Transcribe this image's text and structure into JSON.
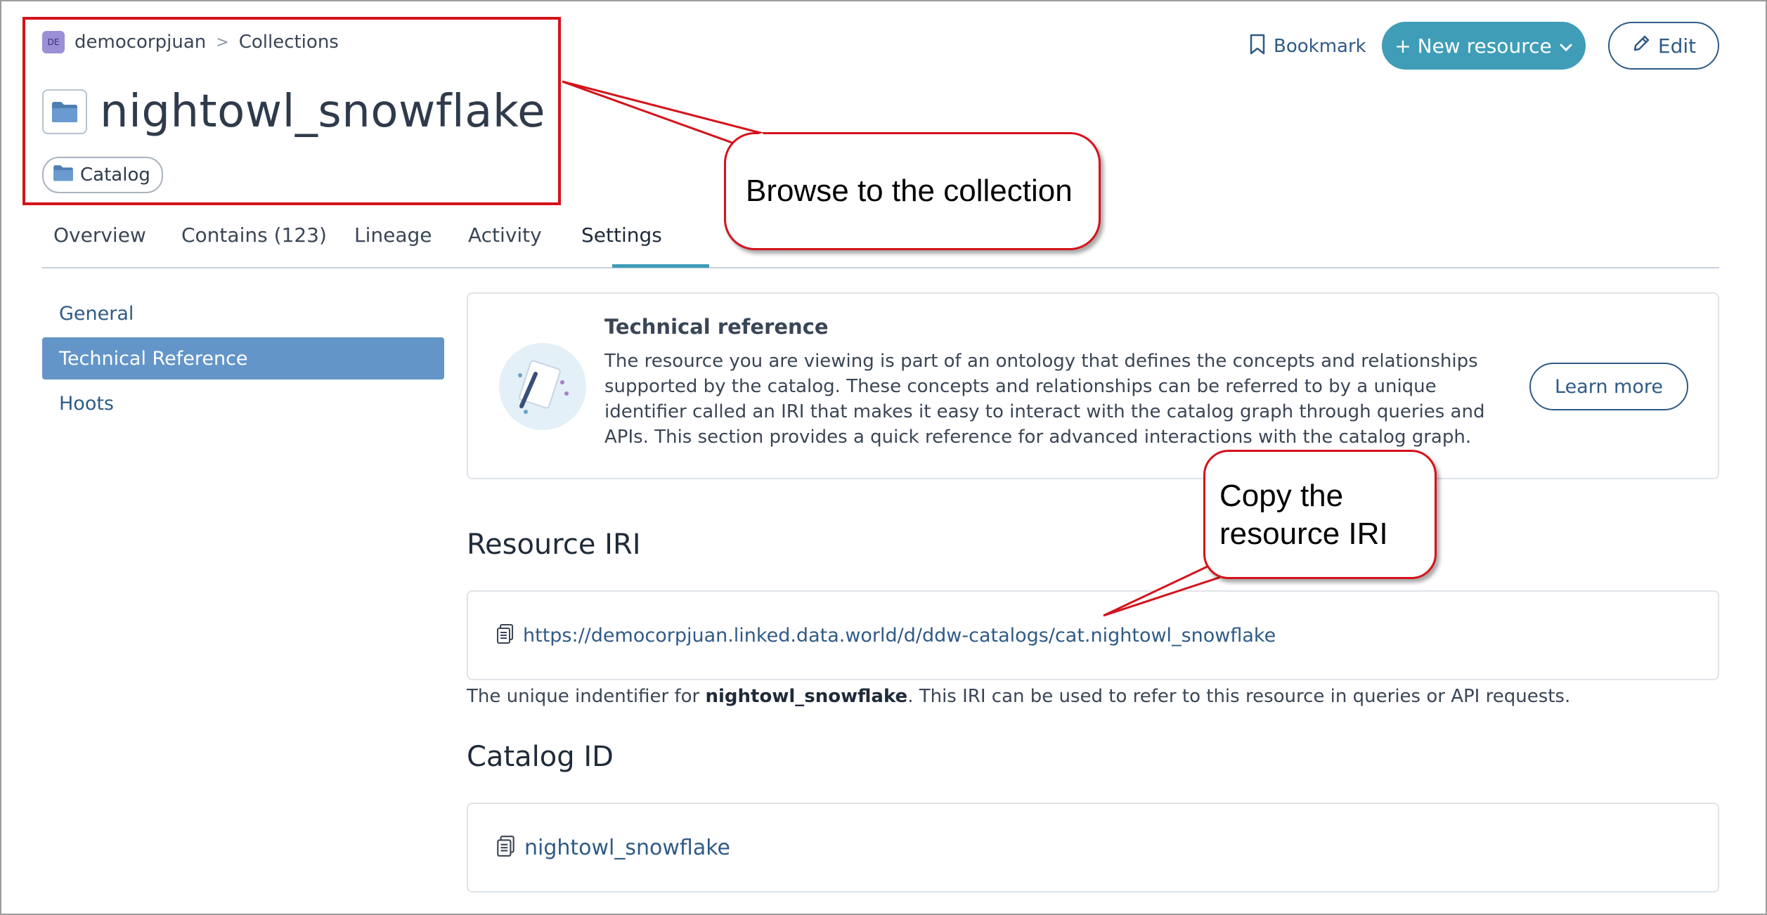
{
  "breadcrumb": {
    "org_badge": "DE",
    "org": "democorpjuan",
    "separator": ">",
    "section": "Collections"
  },
  "resource": {
    "title": "nightowl_snowflake",
    "type_chip": "Catalog"
  },
  "header_actions": {
    "bookmark": "Bookmark",
    "new_resource": "+ New resource",
    "edit": "Edit"
  },
  "tabs": [
    {
      "label": "Overview"
    },
    {
      "label": "Contains (123)"
    },
    {
      "label": "Lineage"
    },
    {
      "label": "Activity"
    },
    {
      "label": "Settings",
      "active": true
    }
  ],
  "settings_nav": [
    {
      "label": "General"
    },
    {
      "label": "Technical Reference",
      "active": true
    },
    {
      "label": "Hoots"
    }
  ],
  "technical_reference": {
    "title": "Technical reference",
    "body": "The resource you are viewing is part of an ontology that defines the concepts and relationships supported by the catalog. These concepts and relationships can be referred to by a unique identifier called an IRI that makes it easy to interact with the catalog graph through queries and APIs. This section provides a quick reference for advanced interactions with the catalog graph.",
    "learn_more": "Learn more"
  },
  "resource_iri": {
    "heading": "Resource IRI",
    "value": "https://democorpjuan.linked.data.world/d/ddw-catalogs/cat.nightowl_snowflake",
    "desc_prefix": "The unique indentifier for ",
    "desc_name": "nightowl_snowflake",
    "desc_suffix": ". This IRI can be used to refer to this resource in queries or API requests."
  },
  "catalog_id": {
    "heading": "Catalog ID",
    "value": "nightowl_snowflake"
  },
  "callouts": {
    "browse": "Browse to the collection",
    "copy_line1": "Copy the",
    "copy_line2": "resource IRI"
  },
  "colors": {
    "accent": "#3f9db7",
    "link": "#2f5a86",
    "nav_active": "#6395c8",
    "annotation_red": "#d4131b"
  }
}
